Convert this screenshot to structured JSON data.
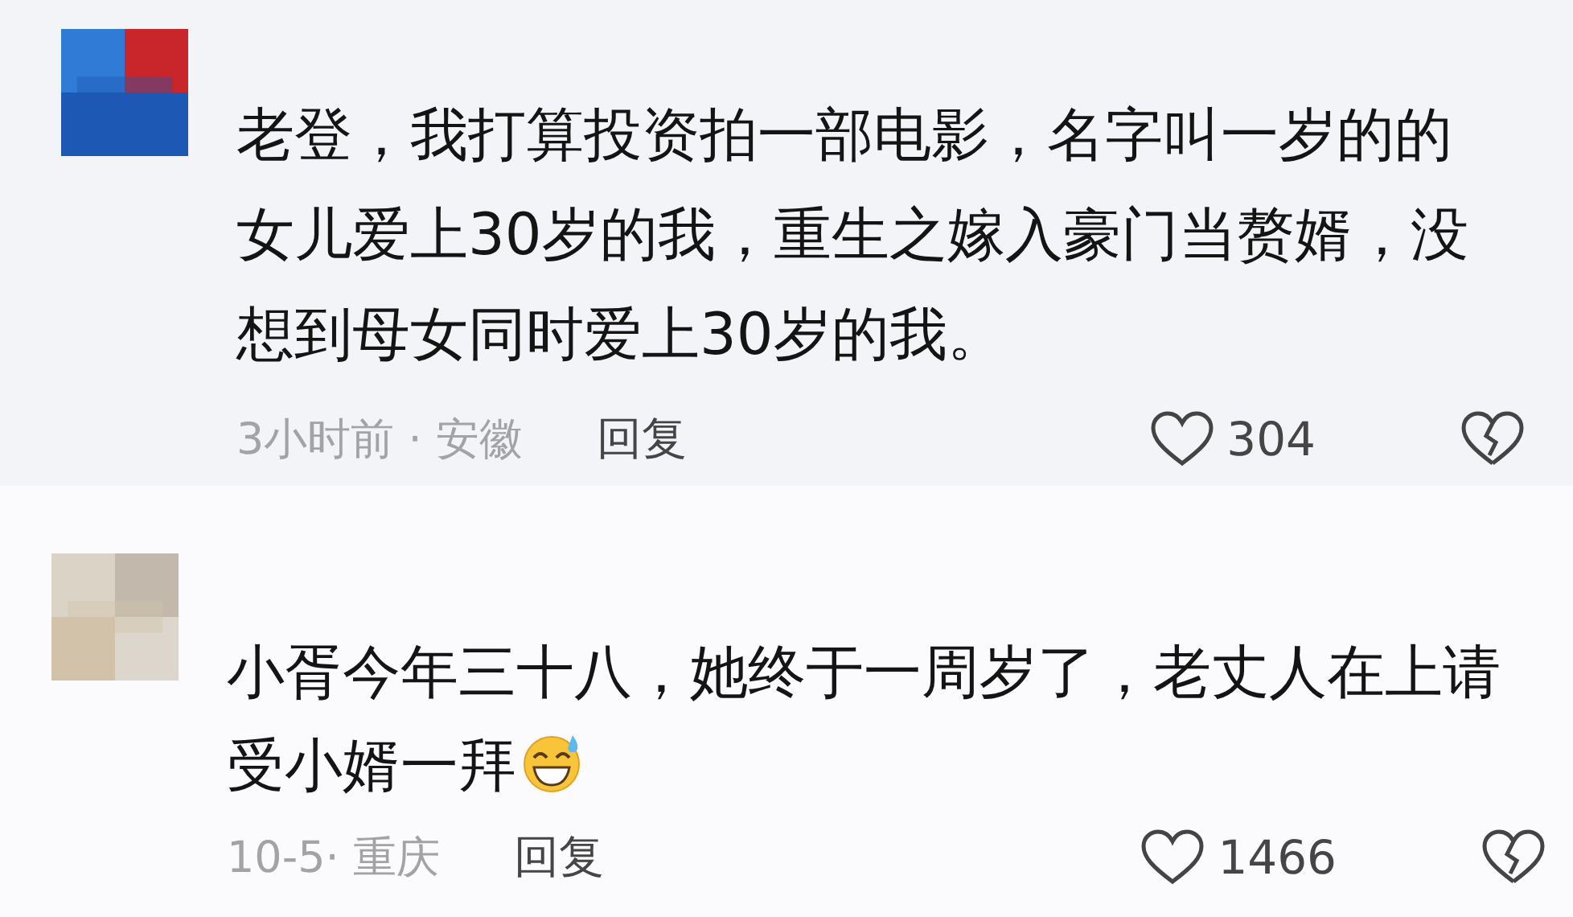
{
  "comments": [
    {
      "text": "老登，我打算投资拍一部电影，名字叫一岁的的女儿爱上30岁的我，重生之嫁入豪门当赘婿，没想到母女同时爱上30岁的我。",
      "emoji": false,
      "meta": "3小时前 · 安徽",
      "reply": "回复",
      "likes": "304",
      "highlighted": true
    },
    {
      "text": "小胥今年三十八，她终于一周岁了，老丈人在上请受小婿一拜",
      "emoji": true,
      "meta": "10-5· 重庆",
      "reply": "回复",
      "likes": "1466",
      "highlighted": false
    }
  ]
}
